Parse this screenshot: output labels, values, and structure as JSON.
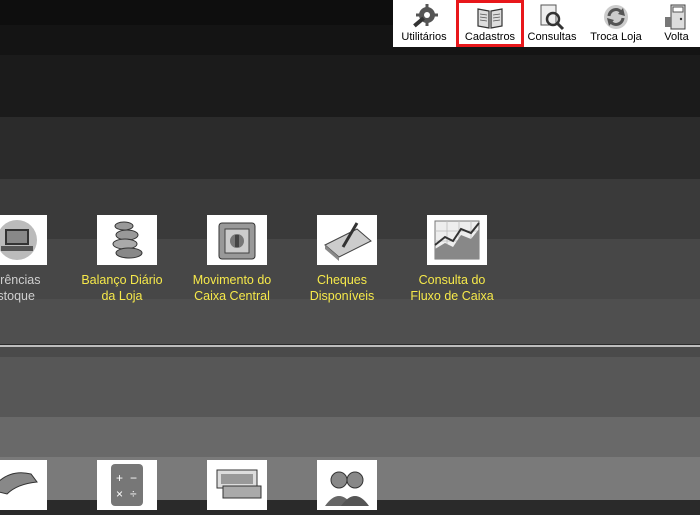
{
  "toolbar": {
    "items": [
      {
        "label": "Utilitários",
        "icon": "gear-icon"
      },
      {
        "label": "Cadastros",
        "icon": "book-icon",
        "selected": true
      },
      {
        "label": "Consultas",
        "icon": "search-document-icon"
      },
      {
        "label": "Troca Loja",
        "icon": "refresh-icon"
      },
      {
        "label": "Volta",
        "icon": "exit-door-icon"
      }
    ],
    "selected_color": "#e8171b"
  },
  "tiles_row1": [
    {
      "label": "sferências\nEstoque",
      "icon": "transfer-computer-icon"
    },
    {
      "label": "Balanço Diário\nda Loja",
      "icon": "coins-icon"
    },
    {
      "label": "Movimento do\nCaixa Central",
      "icon": "bank-vault-icon"
    },
    {
      "label": "Cheques\nDisponíveis",
      "icon": "checkbook-icon"
    },
    {
      "label": "Consulta do\nFluxo de Caixa",
      "icon": "cashflow-chart-icon"
    }
  ],
  "tiles_row2": [
    {
      "label": "",
      "icon": "hand-icon"
    },
    {
      "label": "",
      "icon": "calculator-icon"
    },
    {
      "label": "",
      "icon": "banknote-icon"
    },
    {
      "label": "",
      "icon": "users-icon"
    }
  ],
  "colors": {
    "label_text": "#f6e94a",
    "toolbar_bg": "#ffffff"
  }
}
